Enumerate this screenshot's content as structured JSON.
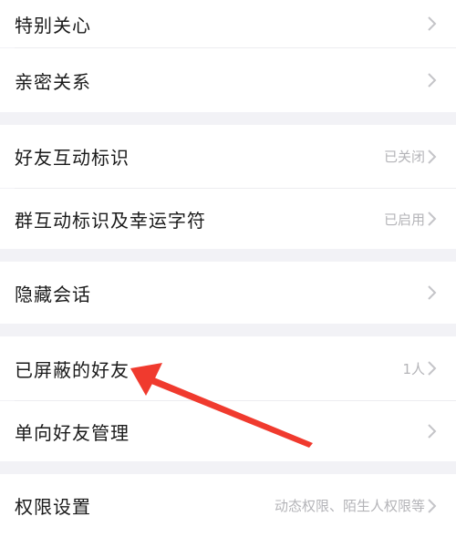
{
  "settings": {
    "items": [
      {
        "label": "特别关心",
        "value": ""
      },
      {
        "label": "亲密关系",
        "value": ""
      },
      {
        "label": "好友互动标识",
        "value": "已关闭"
      },
      {
        "label": "群互动标识及幸运字符",
        "value": "已启用"
      },
      {
        "label": "隐藏会话",
        "value": ""
      },
      {
        "label": "已屏蔽的好友",
        "value": "1人"
      },
      {
        "label": "单向好友管理",
        "value": ""
      },
      {
        "label": "权限设置",
        "value": "动态权限、陌生人权限等"
      }
    ]
  },
  "annotation": {
    "color": "#f03a2e"
  },
  "colors": {
    "background": "#f2f2f6",
    "row": "#ffffff",
    "chevron": "#c4c4c8"
  }
}
